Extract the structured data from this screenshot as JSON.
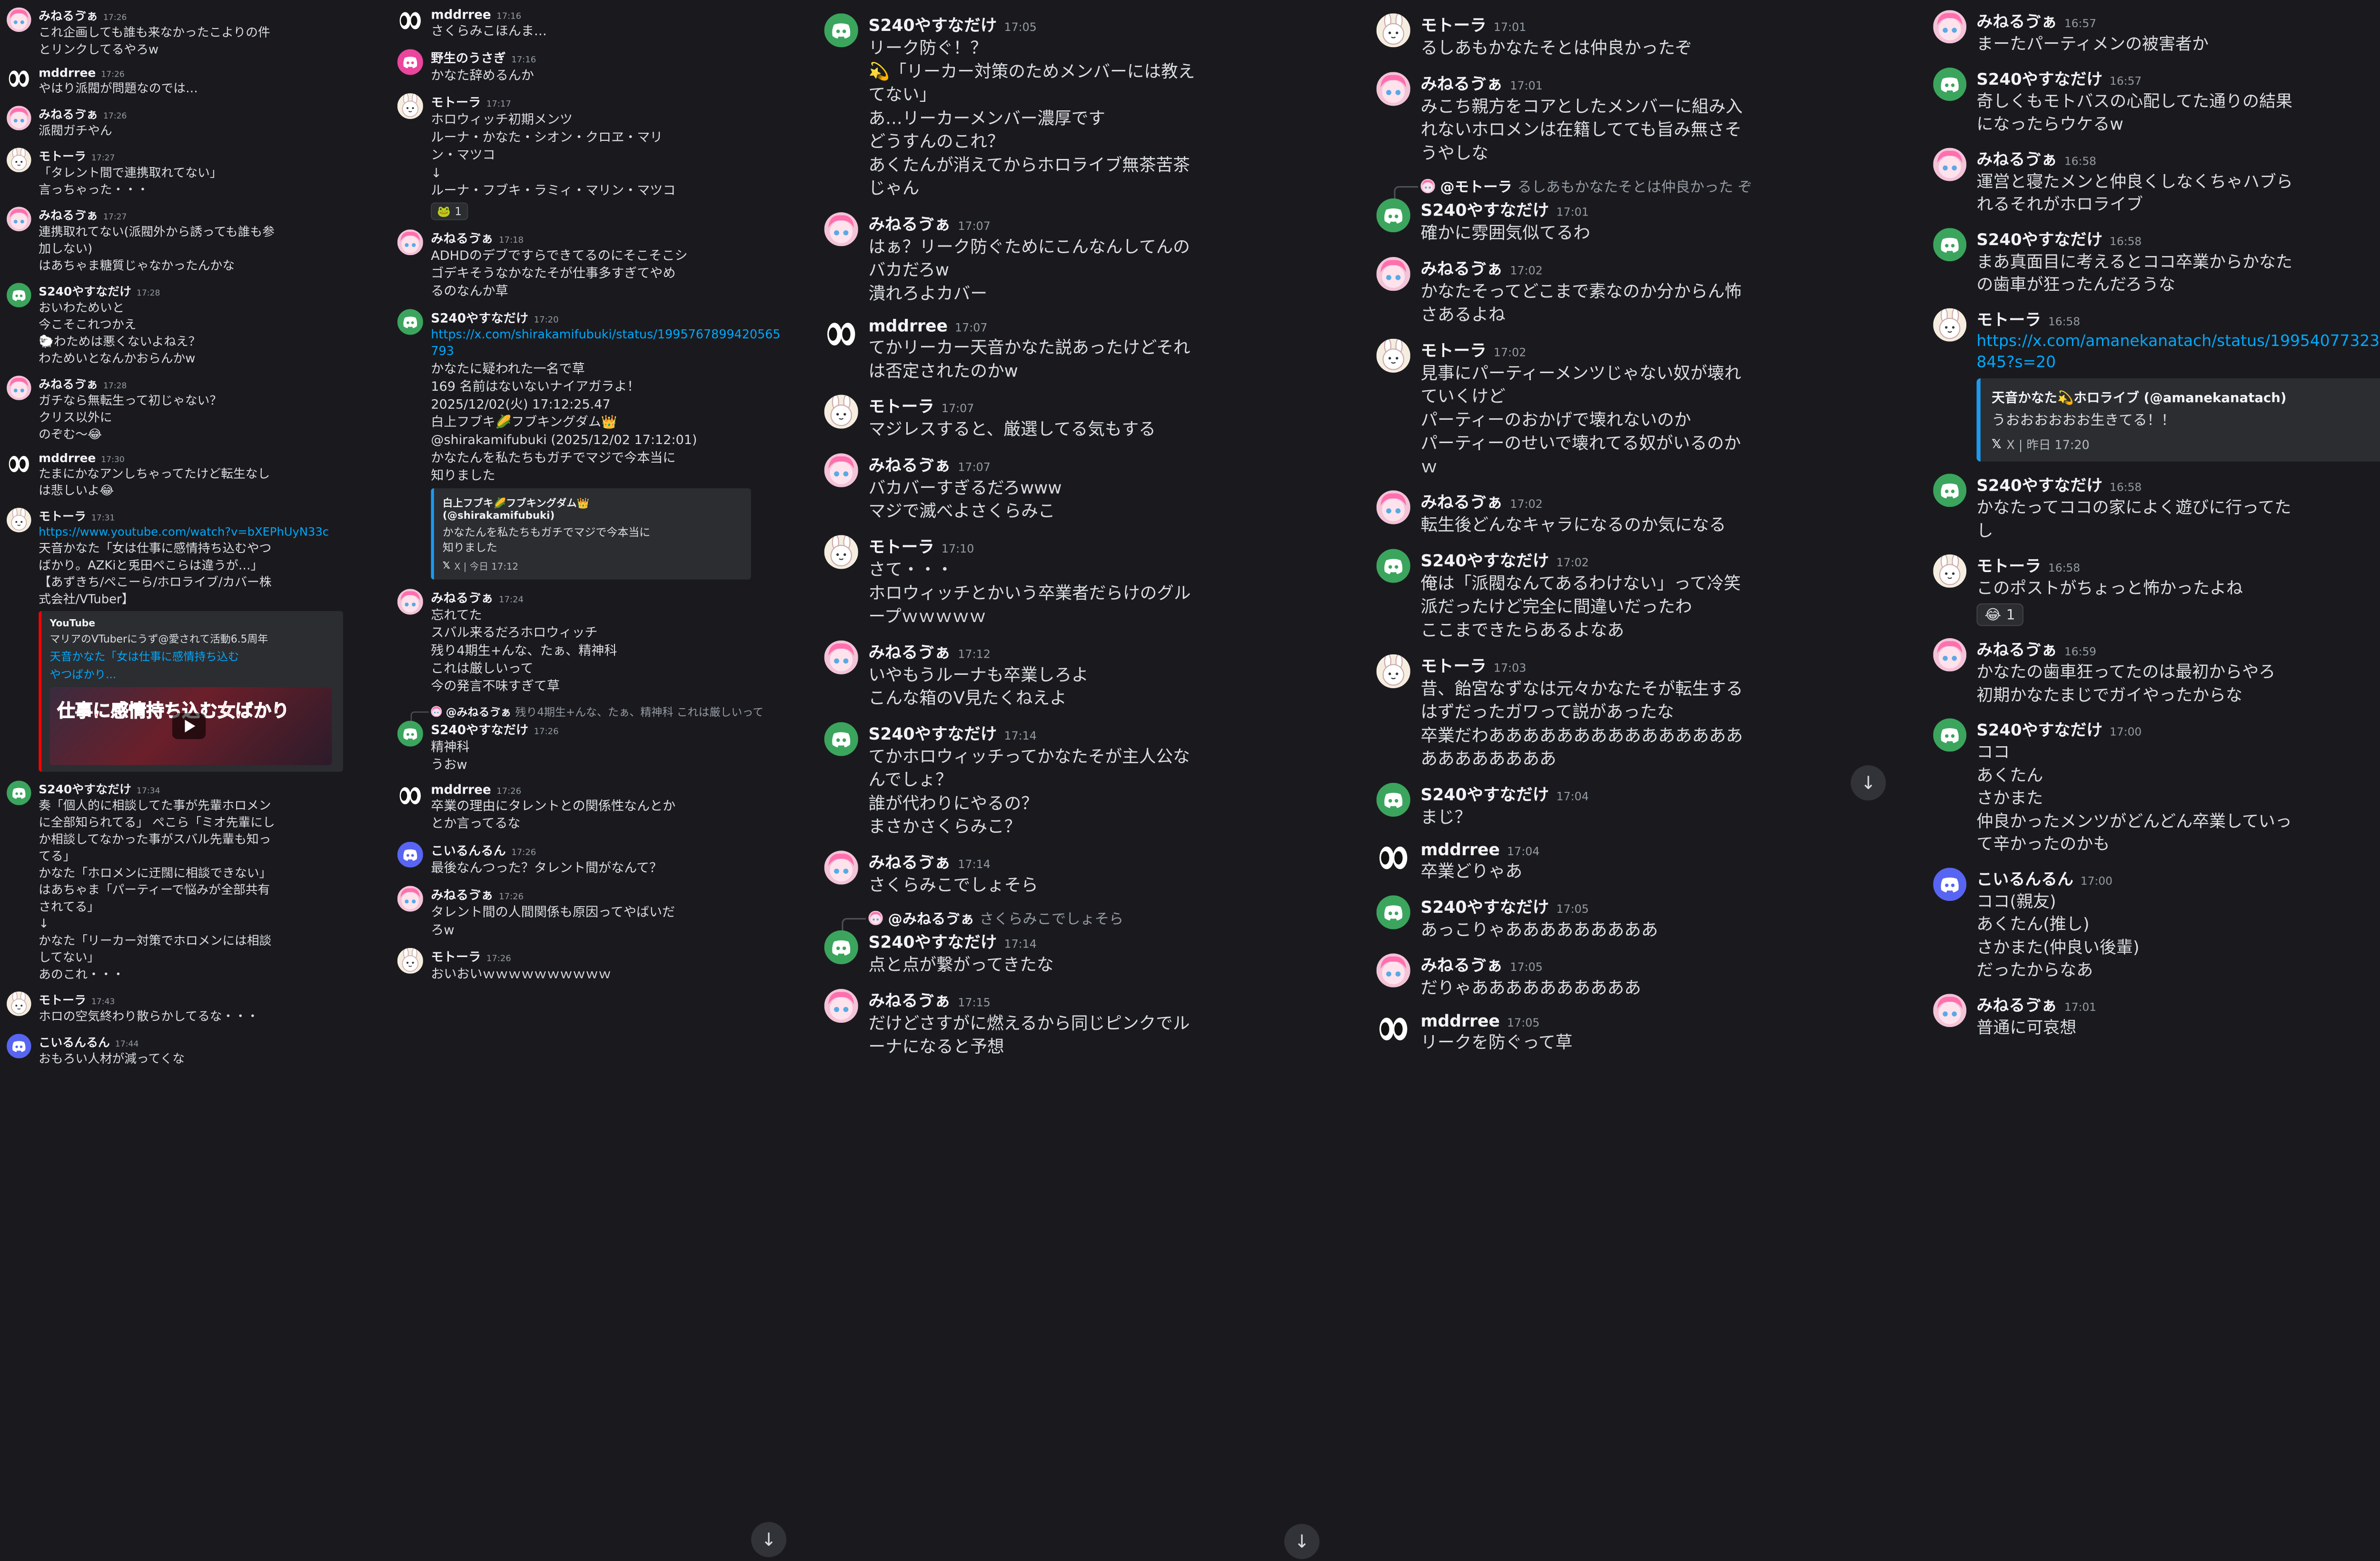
{
  "columns": [
    {
      "messages": [
        {
          "avatar": "pink",
          "name": "みねるゔぁ",
          "time": "17:26",
          "lines": [
            "これ企画しても誰も来なかったこよりの件",
            "とリンクしてるやろw"
          ]
        },
        {
          "avatar": "eyes",
          "name": "mddrree",
          "time": "17:26",
          "lines": [
            "やはり派閥が問題なのでは…"
          ]
        },
        {
          "avatar": "pink",
          "name": "みねるゔぁ",
          "time": "17:26",
          "lines": [
            "派閥ガチやん"
          ]
        },
        {
          "avatar": "rabbit",
          "name": "モトーラ",
          "time": "17:27",
          "lines": [
            "「タレント間で連携取れてない」",
            "言っちゃった・・・"
          ]
        },
        {
          "avatar": "pink",
          "name": "みねるゔぁ",
          "time": "17:27",
          "lines": [
            "連携取れてない(派閥外から誘っても誰も参",
            "加しない)",
            "はあちゃま糖質じゃなかったんかな"
          ]
        },
        {
          "avatar": "discord-green",
          "name": "S240やすなだけ",
          "time": "17:28",
          "lines": [
            "おいわためいと",
            "",
            "今こそこれつかえ",
            "🐑わためは悪くないよねえ？",
            "わためいとなんかおらんかw"
          ]
        },
        {
          "avatar": "pink",
          "name": "みねるゔぁ",
          "time": "17:28",
          "lines": [
            "ガチなら無転生って初じゃない？",
            "クリス以外に",
            "のぞむ～😂"
          ]
        },
        {
          "avatar": "eyes",
          "name": "mddrree",
          "time": "17:30",
          "lines": [
            "たまにかなアンしちゃってたけど転生なし",
            "は悲しいよ😂"
          ]
        },
        {
          "avatar": "rabbit",
          "name": "モトーラ",
          "time": "17:31",
          "link": "https://www.youtube.com/watch?v=bXEPhUyN33c",
          "lines": [
            "天音かなた「女は仕事に感情持ち込むやつ",
            "ばかり。AZKiと兎田ぺこらは違うが…」",
            "【あずきち/ぺこーら/ホロライブ/カバー株",
            "式会社/VTuber】"
          ],
          "embed": {
            "kind": "yt",
            "author": "YouTube",
            "subtitle": "マリアのVTuberにうず@愛されて活動6.5周年",
            "title": "天音かなた「女は仕事に感情持ち込む",
            "title2": "やつばかり...",
            "thumb": "仕事に感情持ち込む女ばかり"
          }
        },
        {
          "avatar": "discord-green",
          "name": "S240やすなだけ",
          "time": "17:34",
          "lines": [
            "奏「個人的に相談してた事が先輩ホロメン",
            "に全部知られてる」 ぺこら「ミオ先輩にし",
            "か相談してなかった事がスバル先輩も知っ",
            "てる」",
            "かなた「ホロメンに迂闊に相談できない」",
            "はあちゃま「パーティーで悩みが全部共有",
            "されてる」",
            "↓",
            "かなた「リーカー対策でホロメンには相談",
            "してない」",
            "",
            "",
            "あのこれ・・・"
          ]
        },
        {
          "avatar": "rabbit",
          "name": "モトーラ",
          "time": "17:43",
          "lines": [
            "ホロの空気終わり散らかしてるな・・・"
          ]
        },
        {
          "avatar": "discord-blue",
          "name": "こいるんるん",
          "time": "17:44",
          "lines": [
            "おもろい人材が減ってくな"
          ]
        }
      ]
    },
    {
      "messages": [
        {
          "avatar": "eyes",
          "name": "mddrree",
          "time": "17:16",
          "lines": [
            "さくらみこほんま…"
          ]
        },
        {
          "avatar": "discord-pink",
          "name": "野生のうさぎ",
          "time": "17:16",
          "lines": [
            "かなた辞めるんか"
          ]
        },
        {
          "avatar": "rabbit",
          "name": "モトーラ",
          "time": "17:17",
          "lines": [
            "ホロウィッチ初期メンツ",
            "ルーナ・かなた・シオン・クロヱ・マリ",
            "ン・マツコ",
            "↓",
            "ルーナ・フブキ・ラミィ・マリン・マツコ"
          ],
          "reaction": {
            "emoji": "🐸",
            "count": "1"
          }
        },
        {
          "avatar": "pink",
          "name": "みねるゔぁ",
          "time": "17:18",
          "lines": [
            "ADHDのデブですらできてるのにそこそこシ",
            "ゴデキそうなかなたそが仕事多すぎてやめ",
            "るのなんか草"
          ]
        },
        {
          "avatar": "discord-green",
          "name": "S240やすなだけ",
          "time": "17:20",
          "lines": [
            "かなたに疑われた一名で草",
            "",
            "169 名前はないないナイアガラよ！",
            "2025/12/02(火) 17:12:25.47",
            "白上フブキ🌽フブキングダム👑",
            "@shirakamifubuki (2025/12/02 17:12:01)",
            "かなたんを私たちもガチでマジで今本当に",
            "知りました"
          ],
          "link": "https://x.com/shirakamifubuki/status/1995767899420565793",
          "embed": {
            "kind": "x",
            "author": "白上フブキ🌽フブキングダム👑",
            "handle": "(@shirakamifubuki)",
            "desc": "かなたんを私たちもガチでマジで今本当に\n知りました",
            "foot": "X | 今日 17:12"
          }
        },
        {
          "avatar": "pink",
          "name": "みねるゔぁ",
          "time": "17:24",
          "lines": [
            "忘れてた",
            "スバル来るだろホロウィッチ",
            "残り4期生+んな、たぁ、精神科",
            "",
            "これは厳しいって",
            "今の発言不味すぎて草"
          ]
        },
        {
          "avatar": "discord-green",
          "name": "S240やすなだけ",
          "time": "17:26",
          "replyTo": {
            "name": "@みねるゔぁ",
            "text": "残り4期生+んな、たぁ、精神科 これは厳しいって"
          },
          "lines": [
            "精神科",
            "",
            "うおw"
          ]
        },
        {
          "avatar": "eyes",
          "name": "mddrree",
          "time": "17:26",
          "lines": [
            "卒業の理由にタレントとの関係性なんとか",
            "とか言ってるな"
          ]
        },
        {
          "avatar": "discord-blue",
          "name": "こいるんるん",
          "time": "17:26",
          "lines": [
            "最後なんつった？タレント間がなんて？"
          ]
        },
        {
          "avatar": "pink",
          "name": "みねるゔぁ",
          "time": "17:26",
          "lines": [
            "タレント間の人間関係も原因ってやばいだ",
            "ろw"
          ]
        },
        {
          "avatar": "rabbit",
          "name": "モトーラ",
          "time": "17:26",
          "lines": [
            "おいおいｗｗｗｗｗｗｗｗｗｗ"
          ]
        }
      ]
    },
    {
      "messages": [
        {
          "avatar": "discord-green",
          "name": "S240やすなだけ",
          "time": "17:05",
          "lines": [
            "リーク防ぐ！？",
            "💫「リーカー対策のためメンバーには教え",
            "てない」",
            "",
            "あ…リーカーメンバー濃厚です",
            "どうすんのこれ？",
            "あくたんが消えてからホロライブ無茶苦茶",
            "じゃん"
          ]
        },
        {
          "avatar": "pink",
          "name": "みねるゔぁ",
          "time": "17:07",
          "lines": [
            "はぁ？リーク防ぐためにこんなんしてんの",
            "バカだろw",
            "潰れろよカバー"
          ]
        },
        {
          "avatar": "eyes",
          "name": "mddrree",
          "time": "17:07",
          "lines": [
            "てかリーカー天音かなた説あったけどそれ",
            "は否定されたのかw"
          ]
        },
        {
          "avatar": "rabbit",
          "name": "モトーラ",
          "time": "17:07",
          "lines": [
            "マジレスすると、厳選してる気もする"
          ]
        },
        {
          "avatar": "pink",
          "name": "みねるゔぁ",
          "time": "17:07",
          "lines": [
            "バカバーすぎるだろwww",
            "マジで滅べよさくらみこ"
          ]
        },
        {
          "avatar": "rabbit",
          "name": "モトーラ",
          "time": "17:10",
          "lines": [
            "さて・・・",
            "ホロウィッチとかいう卒業者だらけのグル",
            "ープｗｗｗｗｗ"
          ]
        },
        {
          "avatar": "pink",
          "name": "みねるゔぁ",
          "time": "17:12",
          "lines": [
            "いやもうルーナも卒業しろよ",
            "こんな箱のV見たくねえよ"
          ]
        },
        {
          "avatar": "discord-green",
          "name": "S240やすなだけ",
          "time": "17:14",
          "lines": [
            "てかホロウィッチってかなたそが主人公な",
            "んでしょ？",
            "",
            "誰が代わりにやるの？",
            "",
            "",
            "まさかさくらみこ？"
          ]
        },
        {
          "avatar": "pink",
          "name": "みねるゔぁ",
          "time": "17:14",
          "lines": [
            "さくらみこでしょそら"
          ]
        },
        {
          "avatar": "discord-green",
          "name": "S240やすなだけ",
          "time": "17:14",
          "replyTo": {
            "name": "@みねるゔぁ",
            "text": "さくらみこでしょそら"
          },
          "lines": [
            "点と点が繋がってきたな"
          ]
        },
        {
          "avatar": "pink",
          "name": "みねるゔぁ",
          "time": "17:15",
          "lines": [
            "だけどさすがに燃えるから同じピンクでル",
            "ーナになると予想"
          ]
        }
      ]
    },
    {
      "messages": [
        {
          "avatar": "rabbit",
          "name": "モトーラ",
          "time": "17:01",
          "lines": [
            "るしあもかなたそとは仲良かったぞ"
          ]
        },
        {
          "avatar": "pink",
          "name": "みねるゔぁ",
          "time": "17:01",
          "lines": [
            "みこち親方をコアとしたメンバーに組み入",
            "れないホロメンは在籍してても旨み無さそ",
            "うやしな"
          ]
        },
        {
          "avatar": "discord-green",
          "name": "S240やすなだけ",
          "time": "17:01",
          "replyTo": {
            "name": "@モトーラ",
            "text": "るしあもかなたそとは仲良かった ぞ"
          },
          "lines": [
            "確かに雰囲気似てるわ"
          ]
        },
        {
          "avatar": "pink",
          "name": "みねるゔぁ",
          "time": "17:02",
          "lines": [
            "かなたそってどこまで素なのか分からん怖",
            "さあるよね"
          ]
        },
        {
          "avatar": "rabbit",
          "name": "モトーラ",
          "time": "17:02",
          "lines": [
            "見事にパーティーメンツじゃない奴が壊れ",
            "ていくけど",
            "",
            "パーティーのおかげで壊れないのか",
            "",
            "パーティーのせいで壊れてる奴がいるのか",
            "ｗ"
          ]
        },
        {
          "avatar": "pink",
          "name": "みねるゔぁ",
          "time": "17:02",
          "lines": [
            "転生後どんなキャラになるのか気になる"
          ]
        },
        {
          "avatar": "discord-green",
          "name": "S240やすなだけ",
          "time": "17:02",
          "lines": [
            "俺は「派閥なんてあるわけない」って冷笑",
            "派だったけど完全に間違いだったわ",
            "",
            "ここまできたらあるよなあ"
          ]
        },
        {
          "avatar": "rabbit",
          "name": "モトーラ",
          "time": "17:03",
          "lines": [
            "昔、飴宮なずなは元々かなたそが転生する",
            "はずだったガワって説があったな",
            "卒業だわあああああああああああああああ",
            "ああああああああ"
          ]
        },
        {
          "avatar": "discord-green",
          "name": "S240やすなだけ",
          "time": "17:04",
          "lines": [
            "まじ？"
          ]
        },
        {
          "avatar": "eyes",
          "name": "mddrree",
          "time": "17:04",
          "lines": [
            "卒業どりゃあ"
          ]
        },
        {
          "avatar": "discord-green",
          "name": "S240やすなだけ",
          "time": "17:05",
          "lines": [
            "あっこりゃあああああああああ"
          ]
        },
        {
          "avatar": "pink",
          "name": "みねるゔぁ",
          "time": "17:05",
          "lines": [
            "だりゃああああああああああ"
          ]
        },
        {
          "avatar": "eyes",
          "name": "mddrree",
          "time": "17:05",
          "lines": [
            "リークを防ぐって草"
          ]
        }
      ]
    },
    {
      "messages": [
        {
          "avatar": "pink",
          "name": "みねるゔぁ",
          "time": "16:57",
          "lines": [
            "まーたパーティメンの被害者か"
          ]
        },
        {
          "avatar": "discord-green",
          "name": "S240やすなだけ",
          "time": "16:57",
          "lines": [
            "奇しくもモトバスの心配してた通りの結果",
            "になったらウケるw"
          ]
        },
        {
          "avatar": "pink",
          "name": "みねるゔぁ",
          "time": "16:58",
          "lines": [
            "運営と寝たメンと仲良くしなくちゃハブら",
            "れるそれがホロライブ"
          ]
        },
        {
          "avatar": "discord-green",
          "name": "S240やすなだけ",
          "time": "16:58",
          "lines": [
            "まあ真面目に考えるとココ卒業からかなた",
            "の歯車が狂ったんだろうな"
          ]
        },
        {
          "avatar": "rabbit",
          "name": "モトーラ",
          "time": "16:58",
          "link": "https://x.com/amanekanatach/status/1995407732313329845?s=20",
          "lines": [],
          "embed": {
            "kind": "x",
            "author": "天音かなた💫ホロライブ (@amanekanatach)",
            "handle": "",
            "desc": "うおおおおおお生きてる！！",
            "foot": "X | 昨日 17:20"
          }
        },
        {
          "avatar": "discord-green",
          "name": "S240やすなだけ",
          "time": "16:58",
          "lines": [
            "かなたってココの家によく遊びに行ってた",
            "し"
          ]
        },
        {
          "avatar": "rabbit",
          "name": "モトーラ",
          "time": "16:58",
          "lines": [
            "このポストがちょっと怖かったよね"
          ],
          "reaction": {
            "emoji": "😂",
            "count": "1"
          }
        },
        {
          "avatar": "pink",
          "name": "みねるゔぁ",
          "time": "16:59",
          "lines": [
            "かなたの歯車狂ってたのは最初からやろ",
            "初期かなたまじでガイやったからな"
          ]
        },
        {
          "avatar": "discord-green",
          "name": "S240やすなだけ",
          "time": "17:00",
          "lines": [
            "ココ",
            "",
            "あくたん",
            "",
            "さかまた",
            "",
            "",
            "仲良かったメンツがどんどん卒業していっ",
            "て辛かったのかも"
          ]
        },
        {
          "avatar": "discord-blue",
          "name": "こいるんるん",
          "time": "17:00",
          "lines": [
            "ココ(親友)",
            "",
            "あくたん(推し)",
            "",
            "さかまた(仲良い後輩)",
            "",
            "だったからなあ"
          ]
        },
        {
          "avatar": "pink",
          "name": "みねるゔぁ",
          "time": "17:01",
          "lines": [
            "普通に可哀想"
          ]
        }
      ]
    }
  ],
  "icons": {
    "jump": "arrow-down-icon"
  },
  "colors": {
    "bg": "#1a1a1e",
    "link": "#00a8fc",
    "discord_green": "#3ba55d",
    "discord_blue": "#5865f2",
    "discord_pink": "#eb459e"
  }
}
